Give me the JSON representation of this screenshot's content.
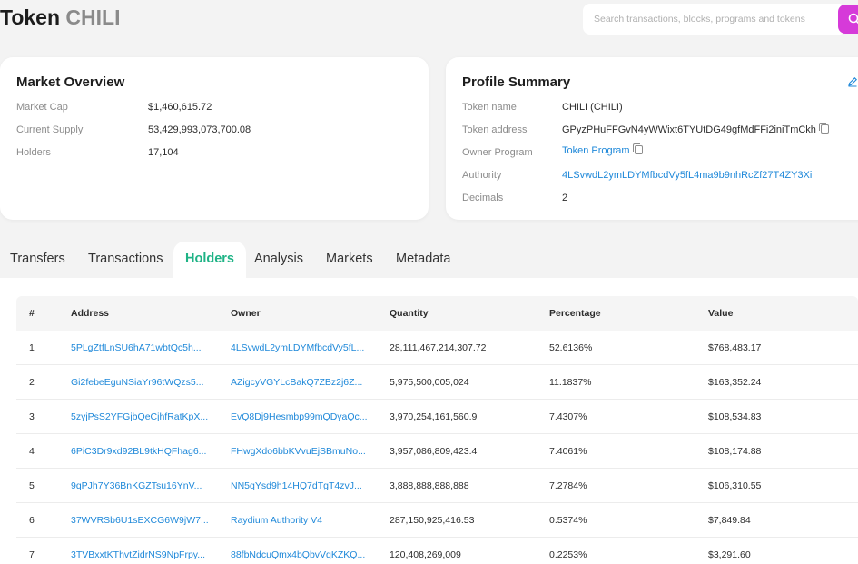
{
  "header": {
    "title_prefix": "Token",
    "title_symbol": "CHILI",
    "search_placeholder": "Search transactions, blocks, programs and tokens"
  },
  "market_overview": {
    "title": "Market Overview",
    "rows": [
      {
        "label": "Market Cap",
        "value": "$1,460,615.72"
      },
      {
        "label": "Current Supply",
        "value": "53,429,993,073,700.08"
      },
      {
        "label": "Holders",
        "value": "17,104"
      }
    ]
  },
  "profile_summary": {
    "title": "Profile Summary",
    "token_name_label": "Token name",
    "token_name": "CHILI (CHILI)",
    "token_address_label": "Token address",
    "token_address": "GPyzPHuFFGvN4yWWixt6TYUtDG49gfMdFFi2iniTmCkh",
    "owner_program_label": "Owner Program",
    "owner_program": "Token Program",
    "authority_label": "Authority",
    "authority": "4LSvwdL2ymLDYMfbcdVy5fL4ma9b9nhRcZf27T4ZY3Xi",
    "decimals_label": "Decimals",
    "decimals": "2"
  },
  "tabs": [
    {
      "label": "Transfers"
    },
    {
      "label": "Transactions"
    },
    {
      "label": "Holders"
    },
    {
      "label": "Analysis"
    },
    {
      "label": "Markets"
    },
    {
      "label": "Metadata"
    }
  ],
  "active_tab": "Holders",
  "holders_table": {
    "columns": [
      "#",
      "Address",
      "Owner",
      "Quantity",
      "Percentage",
      "Value"
    ],
    "rows": [
      [
        "1",
        "5PLgZtfLnSU6hA71wbtQc5h...",
        "4LSvwdL2ymLDYMfbcdVy5fL...",
        "28,111,467,214,307.72",
        "52.6136%",
        "$768,483.17"
      ],
      [
        "2",
        "Gi2febeEguNSiaYr96tWQzs5...",
        "AZigcyVGYLcBakQ7ZBz2j6Z...",
        "5,975,500,005,024",
        "11.1837%",
        "$163,352.24"
      ],
      [
        "3",
        "5zyjPsS2YFGjbQeCjhfRatKpX...",
        "EvQ8Dj9Hesmbp99mQDyaQc...",
        "3,970,254,161,560.9",
        "7.4307%",
        "$108,534.83"
      ],
      [
        "4",
        "6PiC3Dr9xd92BL9tkHQFhag6...",
        "FHwgXdo6bbKVvuEjSBmuNo...",
        "3,957,086,809,423.4",
        "7.4061%",
        "$108,174.88"
      ],
      [
        "5",
        "9qPJh7Y36BnKGZTsu16YnV...",
        "NN5qYsd9h14HQ7dTgT4zvJ...",
        "3,888,888,888,888",
        "7.2784%",
        "$106,310.55"
      ],
      [
        "6",
        "37WVRSb6U1sEXCG6W9jW7...",
        "Raydium Authority V4",
        "287,150,925,416.53",
        "0.5374%",
        "$7,849.84"
      ],
      [
        "7",
        "3TVBxxtKThvtZidrNS9NpFrpy...",
        "88fbNdcuQmx4bQbvVqKZKQ...",
        "120,408,269,009",
        "0.2253%",
        "$3,291.60"
      ]
    ]
  },
  "colors": {
    "accent_tab": "#1fb386",
    "link": "#1e88d9",
    "search_button": "#d63ad9",
    "background": "#f3f3f3"
  }
}
